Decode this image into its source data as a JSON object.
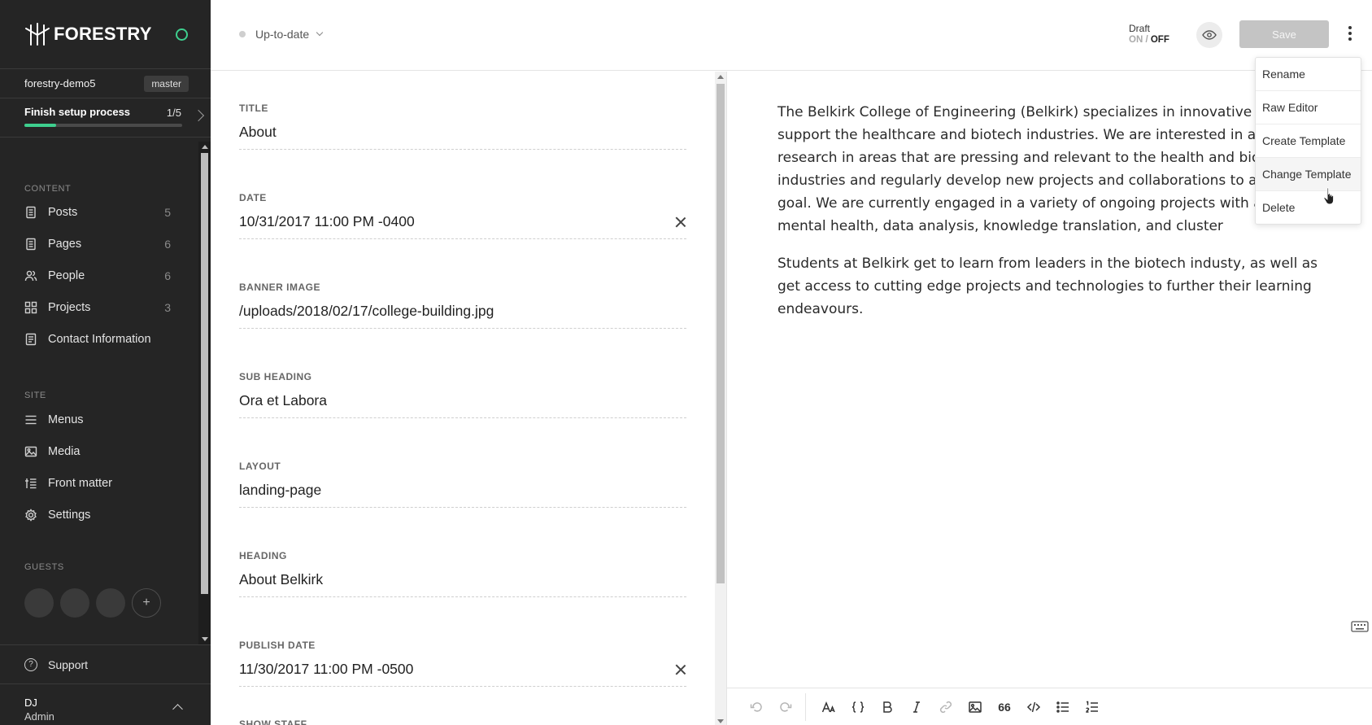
{
  "sidebar": {
    "brand": "FORESTRY",
    "repo": "forestry-demo5",
    "branch": "master",
    "setup": {
      "title": "Finish setup process",
      "count": "1/5",
      "progress": 0.2
    },
    "content_label": "CONTENT",
    "content_items": [
      {
        "label": "Posts",
        "count": "5",
        "icon": "file-icon"
      },
      {
        "label": "Pages",
        "count": "6",
        "icon": "file-icon"
      },
      {
        "label": "People",
        "count": "6",
        "icon": "people-icon"
      },
      {
        "label": "Projects",
        "count": "3",
        "icon": "grid-icon"
      },
      {
        "label": "Contact Information",
        "count": "",
        "icon": "document-icon"
      }
    ],
    "site_label": "SITE",
    "site_items": [
      {
        "label": "Menus",
        "icon": "menu-icon"
      },
      {
        "label": "Media",
        "icon": "image-icon"
      },
      {
        "label": "Front matter",
        "icon": "sliders-icon"
      },
      {
        "label": "Settings",
        "icon": "gear-icon"
      }
    ],
    "guests_label": "GUESTS",
    "add_guest": "+",
    "support": "Support",
    "user": {
      "initials": "DJ",
      "role": "Admin"
    }
  },
  "topbar": {
    "status": "Up-to-date",
    "draft_label": "Draft",
    "draft_on": "ON",
    "draft_sep": "/",
    "draft_off": "OFF",
    "save": "Save"
  },
  "fields": [
    {
      "label": "TITLE",
      "value": "About",
      "clearable": false
    },
    {
      "label": "DATE",
      "value": "10/31/2017 11:00 PM -0400",
      "clearable": true
    },
    {
      "label": "BANNER IMAGE",
      "value": "/uploads/2018/02/17/college-building.jpg",
      "clearable": false
    },
    {
      "label": "SUB HEADING",
      "value": "Ora et Labora",
      "clearable": false
    },
    {
      "label": "LAYOUT",
      "value": "landing-page",
      "clearable": false
    },
    {
      "label": "HEADING",
      "value": "About Belkirk",
      "clearable": false
    },
    {
      "label": "PUBLISH DATE",
      "value": "11/30/2017 11:00 PM -0500",
      "clearable": true
    },
    {
      "label": "SHOW STAFF",
      "value": "",
      "clearable": false
    }
  ],
  "editor": {
    "paragraphs": [
      "The Belkirk College of Engineering (Belkirk) specializes in innovative rese support the healthcare and biotech industries. We are interested in adva research in areas that are pressing and relevant to the health and biotec industries and regularly develop new projects and collaborations to acco this goal. We are currently engaged in a variety of ongoing projects with areas of mental health, data analysis, knowledge translation, and cluster",
      "Students at Belkirk get to learn from leaders in the biotech industy, as well as get access to cutting edge projects and technologies to further their learning endeavours."
    ],
    "toolbar": {
      "quote": "66"
    }
  },
  "menu": {
    "items": [
      "Rename",
      "Raw Editor",
      "Create Template",
      "Change Template",
      "Delete"
    ],
    "hovered": "Change Template"
  },
  "colors": {
    "accent": "#3ecf8e",
    "sidebar_bg": "#252525",
    "save_disabled": "#c4c4c4"
  }
}
